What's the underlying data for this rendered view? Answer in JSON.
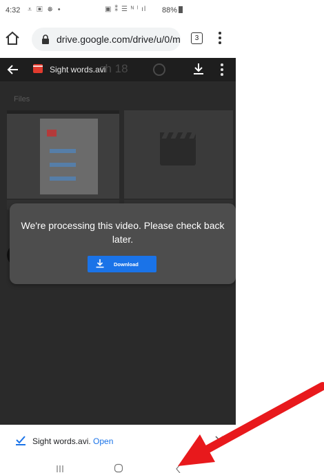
{
  "status_bar": {
    "time": "4:32",
    "notification_icons": "⩡ ▣ ☸ •",
    "system_icons": "▣ ⁑ ☰ ᴺ ˡ ıl",
    "battery": "88%"
  },
  "browser": {
    "url": "drive.google.com/drive/u/0/m",
    "tab_count": "3"
  },
  "viewer": {
    "file_title": "Sight words.avi",
    "background_title": "ch 18",
    "files_label": "Files"
  },
  "dialog": {
    "message": "We're processing this video. Please check back later.",
    "download_label": "Download"
  },
  "download_bar": {
    "file_name": "Sight words.avi.",
    "open_label": "Open"
  },
  "colors": {
    "viewer_bg": "#2a2a2a",
    "dialog_bg": "#4d4d4d",
    "accent_blue": "#1a73e8",
    "annotation_red": "#e8191c"
  }
}
